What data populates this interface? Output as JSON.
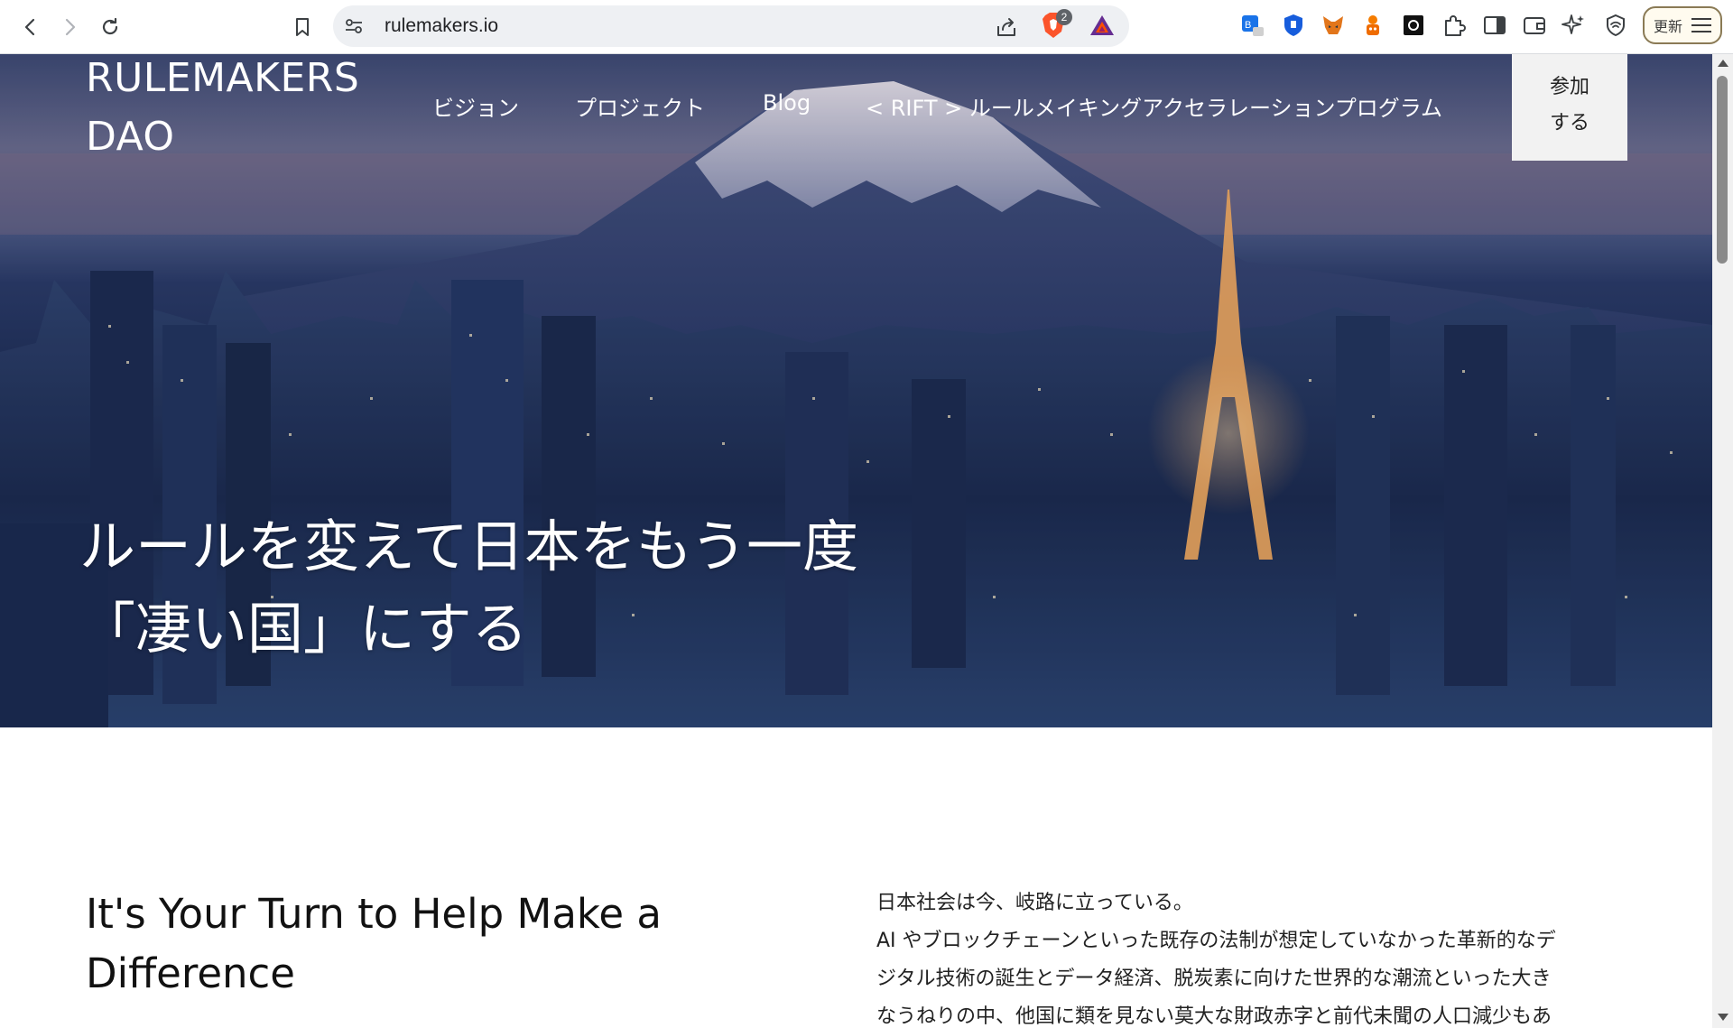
{
  "browser": {
    "url": "rulemakers.io",
    "brave_shield_count": "2",
    "update_label": "更新",
    "extensions": [
      "bitwarden-ext-icon",
      "shield-blue-icon",
      "metamask-fox-icon",
      "orange-bot-icon",
      "dark-square-icon",
      "puzzle-extensions-icon",
      "sidebar-icon",
      "wallet-icon",
      "leo-ai-icon",
      "vpn-shield-icon"
    ]
  },
  "header": {
    "logo_line1": "RULEMAKERS",
    "logo_line2": "DAO",
    "nav": {
      "vision": "ビジョン",
      "projects": "プロジェクト",
      "blog": "Blog",
      "rift": "< RIFT > ルールメイキングアクセラレーションプログラム"
    },
    "join_line1": "参加",
    "join_line2": "する"
  },
  "hero": {
    "title_line1": "ルールを変えて日本をもう一度",
    "title_line2": "「凄い国」にする"
  },
  "intro": {
    "heading_line1": "It's Your Turn to Help Make a",
    "heading_line2": "Difference",
    "paragraph_lines": [
      "日本社会は今、岐路に立っている。",
      "AI やブロックチェーンといった既存の法制が想定していなかった革新的なデ",
      "ジタル技術の誕生とデータ経済、脱炭素に向けた世界的な潮流といった大き",
      "なうねりの中、他国に類を見ない莫大な財政赤字と前代未聞の人口減少もあ"
    ]
  },
  "colors": {
    "hero_sky": "#3e4a73",
    "hero_city": "#172546",
    "join_bg": "#f2f2f2",
    "text_dark": "#111111"
  }
}
